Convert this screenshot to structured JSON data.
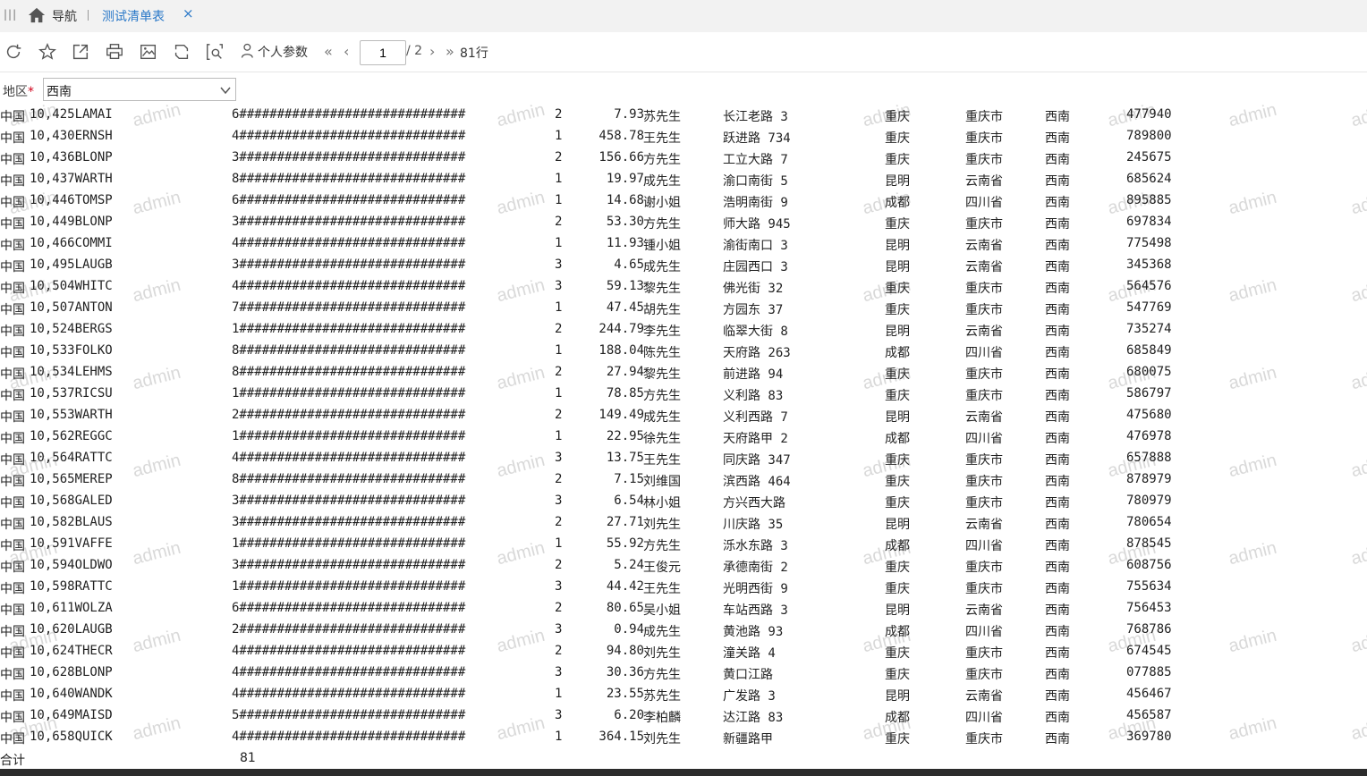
{
  "tabs": {
    "nav_label": "导航",
    "active_tab": "测试清单表",
    "close_glyph": "×"
  },
  "toolbar": {
    "icons": [
      "refresh-icon",
      "star-icon",
      "export-icon",
      "print-icon",
      "image-export-icon",
      "sync-icon",
      "settings-search-icon"
    ],
    "param_label": "个人参数",
    "current_page": "1",
    "total_pages": "/ 2",
    "row_count": "81行"
  },
  "filter": {
    "label": "地区",
    "required_mark": "*",
    "value": "西南"
  },
  "watermark_text": "admin",
  "table": {
    "rows": [
      [
        "10,425LAMAI",
        "6##############################",
        "2",
        "7.93",
        "苏先生",
        "长江老路 3",
        "重庆",
        "重庆市",
        "西南",
        "477940",
        "中国"
      ],
      [
        "10,430ERNSH",
        "4##############################",
        "1",
        "458.78",
        "王先生",
        "跃进路 734",
        "重庆",
        "重庆市",
        "西南",
        "789800",
        "中国"
      ],
      [
        "10,436BLONP",
        "3##############################",
        "2",
        "156.66",
        "方先生",
        "工立大路 7",
        "重庆",
        "重庆市",
        "西南",
        "245675",
        "中国"
      ],
      [
        "10,437WARTH",
        "8##############################",
        "1",
        "19.97",
        "成先生",
        "渝口南街 5",
        "昆明",
        "云南省",
        "西南",
        "685624",
        "中国"
      ],
      [
        "10,446TOMSP",
        "6##############################",
        "1",
        "14.68",
        "谢小姐",
        "浩明南街 9",
        "成都",
        "四川省",
        "西南",
        "895885",
        "中国"
      ],
      [
        "10,449BLONP",
        "3##############################",
        "2",
        "53.30",
        "方先生",
        "师大路 945",
        "重庆",
        "重庆市",
        "西南",
        "697834",
        "中国"
      ],
      [
        "10,466COMMI",
        "4##############################",
        "1",
        "11.93",
        "锺小姐",
        "渝街南口 3",
        "昆明",
        "云南省",
        "西南",
        "775498",
        "中国"
      ],
      [
        "10,495LAUGB",
        "3##############################",
        "3",
        "4.65",
        "成先生",
        "庄园西口 3",
        "昆明",
        "云南省",
        "西南",
        "345368",
        "中国"
      ],
      [
        "10,504WHITC",
        "4##############################",
        "3",
        "59.13",
        "黎先生",
        "佛光街 32 ",
        "重庆",
        "重庆市",
        "西南",
        "564576",
        "中国"
      ],
      [
        "10,507ANTON",
        "7##############################",
        "1",
        "47.45",
        "胡先生",
        "方园东 37 ",
        "重庆",
        "重庆市",
        "西南",
        "547769",
        "中国"
      ],
      [
        "10,524BERGS",
        "1##############################",
        "2",
        "244.79",
        "李先生",
        "临翠大街 8",
        "昆明",
        "云南省",
        "西南",
        "735274",
        "中国"
      ],
      [
        "10,533FOLKO",
        "8##############################",
        "1",
        "188.04",
        "陈先生",
        "天府路 263",
        "成都",
        "四川省",
        "西南",
        "685849",
        "中国"
      ],
      [
        "10,534LEHMS",
        "8##############################",
        "2",
        "27.94",
        "黎先生",
        "前进路 94 ",
        "重庆",
        "重庆市",
        "西南",
        "680075",
        "中国"
      ],
      [
        "10,537RICSU",
        "1##############################",
        "1",
        "78.85",
        "方先生",
        "义利路 83 ",
        "重庆",
        "重庆市",
        "西南",
        "586797",
        "中国"
      ],
      [
        "10,553WARTH",
        "2##############################",
        "2",
        "149.49",
        "成先生",
        "义利西路 7",
        "昆明",
        "云南省",
        "西南",
        "475680",
        "中国"
      ],
      [
        "10,562REGGC",
        "1##############################",
        "1",
        "22.95",
        "徐先生",
        "天府路甲 2",
        "成都",
        "四川省",
        "西南",
        "476978",
        "中国"
      ],
      [
        "10,564RATTC",
        "4##############################",
        "3",
        "13.75",
        "王先生",
        "同庆路 347",
        "重庆",
        "重庆市",
        "西南",
        "657888",
        "中国"
      ],
      [
        "10,565MEREP",
        "8##############################",
        "2",
        "7.15",
        "刘维国",
        "滨西路 464",
        "重庆",
        "重庆市",
        "西南",
        "878979",
        "中国"
      ],
      [
        "10,568GALED",
        "3##############################",
        "3",
        "6.54",
        "林小姐",
        "方兴西大路",
        "重庆",
        "重庆市",
        "西南",
        "780979",
        "中国"
      ],
      [
        "10,582BLAUS",
        "3##############################",
        "2",
        "27.71",
        "刘先生",
        "川庆路 35 ",
        "昆明",
        "云南省",
        "西南",
        "780654",
        "中国"
      ],
      [
        "10,591VAFFE",
        "1##############################",
        "1",
        "55.92",
        "方先生",
        "泺水东路 3",
        "成都",
        "四川省",
        "西南",
        "878545",
        "中国"
      ],
      [
        "10,594OLDWO",
        "3##############################",
        "2",
        "5.24",
        "王俊元",
        "承德南街 2",
        "重庆",
        "重庆市",
        "西南",
        "608756",
        "中国"
      ],
      [
        "10,598RATTC",
        "1##############################",
        "3",
        "44.42",
        "王先生",
        "光明西街 9",
        "重庆",
        "重庆市",
        "西南",
        "755634",
        "中国"
      ],
      [
        "10,611WOLZA",
        "6##############################",
        "2",
        "80.65",
        "吴小姐",
        "车站西路 3",
        "昆明",
        "云南省",
        "西南",
        "756453",
        "中国"
      ],
      [
        "10,620LAUGB",
        "2##############################",
        "3",
        "0.94",
        "成先生",
        "黄池路 93 ",
        "成都",
        "四川省",
        "西南",
        "768786",
        "中国"
      ],
      [
        "10,624THECR",
        "4##############################",
        "2",
        "94.80",
        "刘先生",
        "潼关路 4  ",
        "重庆",
        "重庆市",
        "西南",
        "674545",
        "中国"
      ],
      [
        "10,628BLONP",
        "4##############################",
        "3",
        "30.36",
        "方先生",
        "黄口江路  ",
        "重庆",
        "重庆市",
        "西南",
        "077885",
        "中国"
      ],
      [
        "10,640WANDK",
        "4##############################",
        "1",
        "23.55",
        "苏先生",
        "广发路 3  ",
        "昆明",
        "云南省",
        "西南",
        "456467",
        "中国"
      ],
      [
        "10,649MAISD",
        "5##############################",
        "3",
        "6.20",
        "李柏麟",
        "达江路 83 ",
        "成都",
        "四川省",
        "西南",
        "456587",
        "中国"
      ],
      [
        "10,658QUICK",
        "4##############################",
        "1",
        "364.15",
        "刘先生",
        "新疆路甲  ",
        "重庆",
        "重庆市",
        "西南",
        "369780",
        "中国"
      ]
    ]
  },
  "footer": {
    "label": "合计",
    "value": "81"
  }
}
